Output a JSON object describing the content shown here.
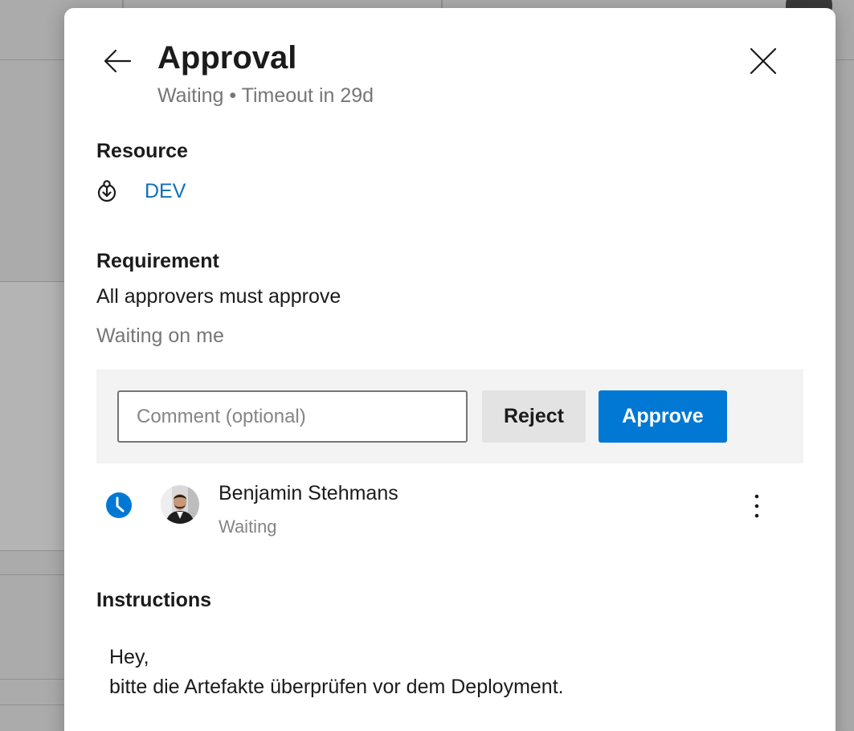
{
  "modal": {
    "title": "Approval",
    "subtitle": "Waiting • Timeout in 29d",
    "back_icon": "arrow-left-icon",
    "close_icon": "close-icon"
  },
  "resource": {
    "label": "Resource",
    "icon": "environment-icon",
    "name": "DEV"
  },
  "requirement": {
    "label": "Requirement",
    "text": "All approvers must approve",
    "status": "Waiting on me"
  },
  "actions": {
    "comment_placeholder": "Comment (optional)",
    "comment_value": "",
    "reject_label": "Reject",
    "approve_label": "Approve",
    "approve_color": "#0078d4"
  },
  "approvers": [
    {
      "name": "Benjamin Stehmans",
      "status": "Waiting",
      "status_icon": "clock-icon",
      "status_color": "#0078d4"
    }
  ],
  "instructions": {
    "label": "Instructions",
    "line1": "Hey,",
    "line2": "bitte die Artefakte überprüfen vor dem Deployment."
  }
}
